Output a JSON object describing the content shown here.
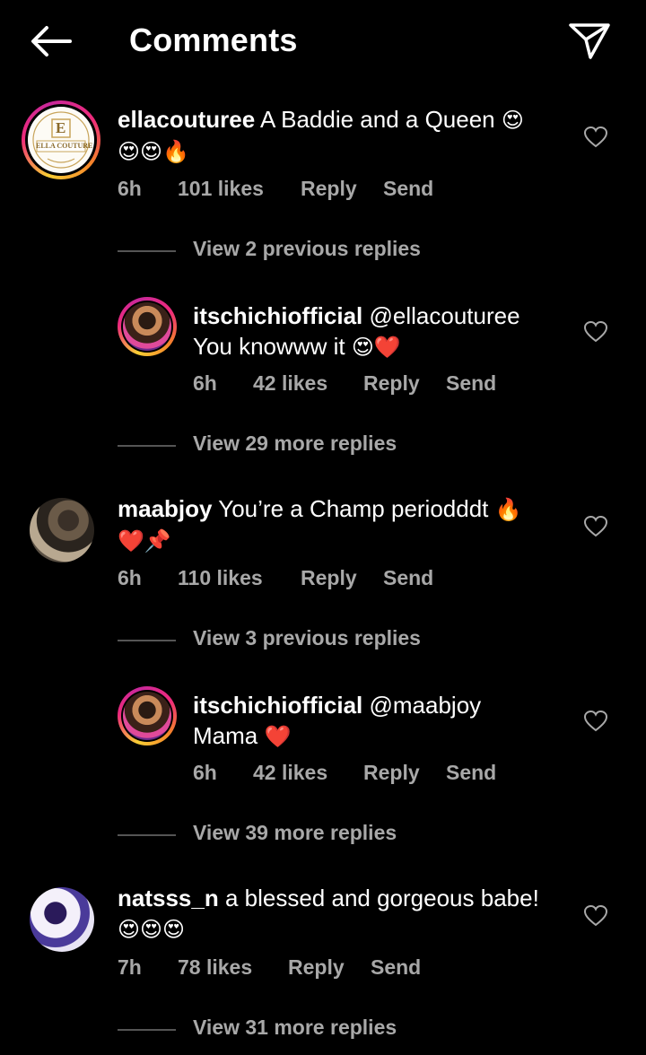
{
  "header": {
    "title": "Comments"
  },
  "comments": [
    {
      "username": "ellacouturee",
      "text": "A Baddie and a Queen",
      "emoji_line1": "😍",
      "emoji_line2": "😍😍🔥",
      "time": "6h",
      "likes": "101 likes",
      "reply": "Reply",
      "send": "Send",
      "avatar_label": "ELLA COUTURE",
      "avatar_monogram": "E"
    },
    {
      "username": "itschichiofficial",
      "mention": "@ellacouturee",
      "text": "You knowww it",
      "emoji": "😍❤️",
      "time": "6h",
      "likes": "42 likes",
      "reply": "Reply",
      "send": "Send"
    },
    {
      "username": "maabjoy",
      "text": "You’re a Champ periodddt",
      "emoji_line1": "🔥",
      "emoji_line2": "❤️📌",
      "time": "6h",
      "likes": "110 likes",
      "reply": "Reply",
      "send": "Send"
    },
    {
      "username": "itschichiofficial",
      "mention": "@maabjoy",
      "text": "Mama",
      "emoji": "❤️",
      "time": "6h",
      "likes": "42 likes",
      "reply": "Reply",
      "send": "Send"
    },
    {
      "username": "natsss_n",
      "text": "a blessed and gorgeous babe!",
      "emoji_line2": "😍😍😍",
      "time": "7h",
      "likes": "78 likes",
      "reply": "Reply",
      "send": "Send"
    }
  ],
  "view_replies": [
    "View 2 previous replies",
    "View 29 more replies",
    "View 3 previous replies",
    "View 39 more replies",
    "View 31 more replies"
  ]
}
